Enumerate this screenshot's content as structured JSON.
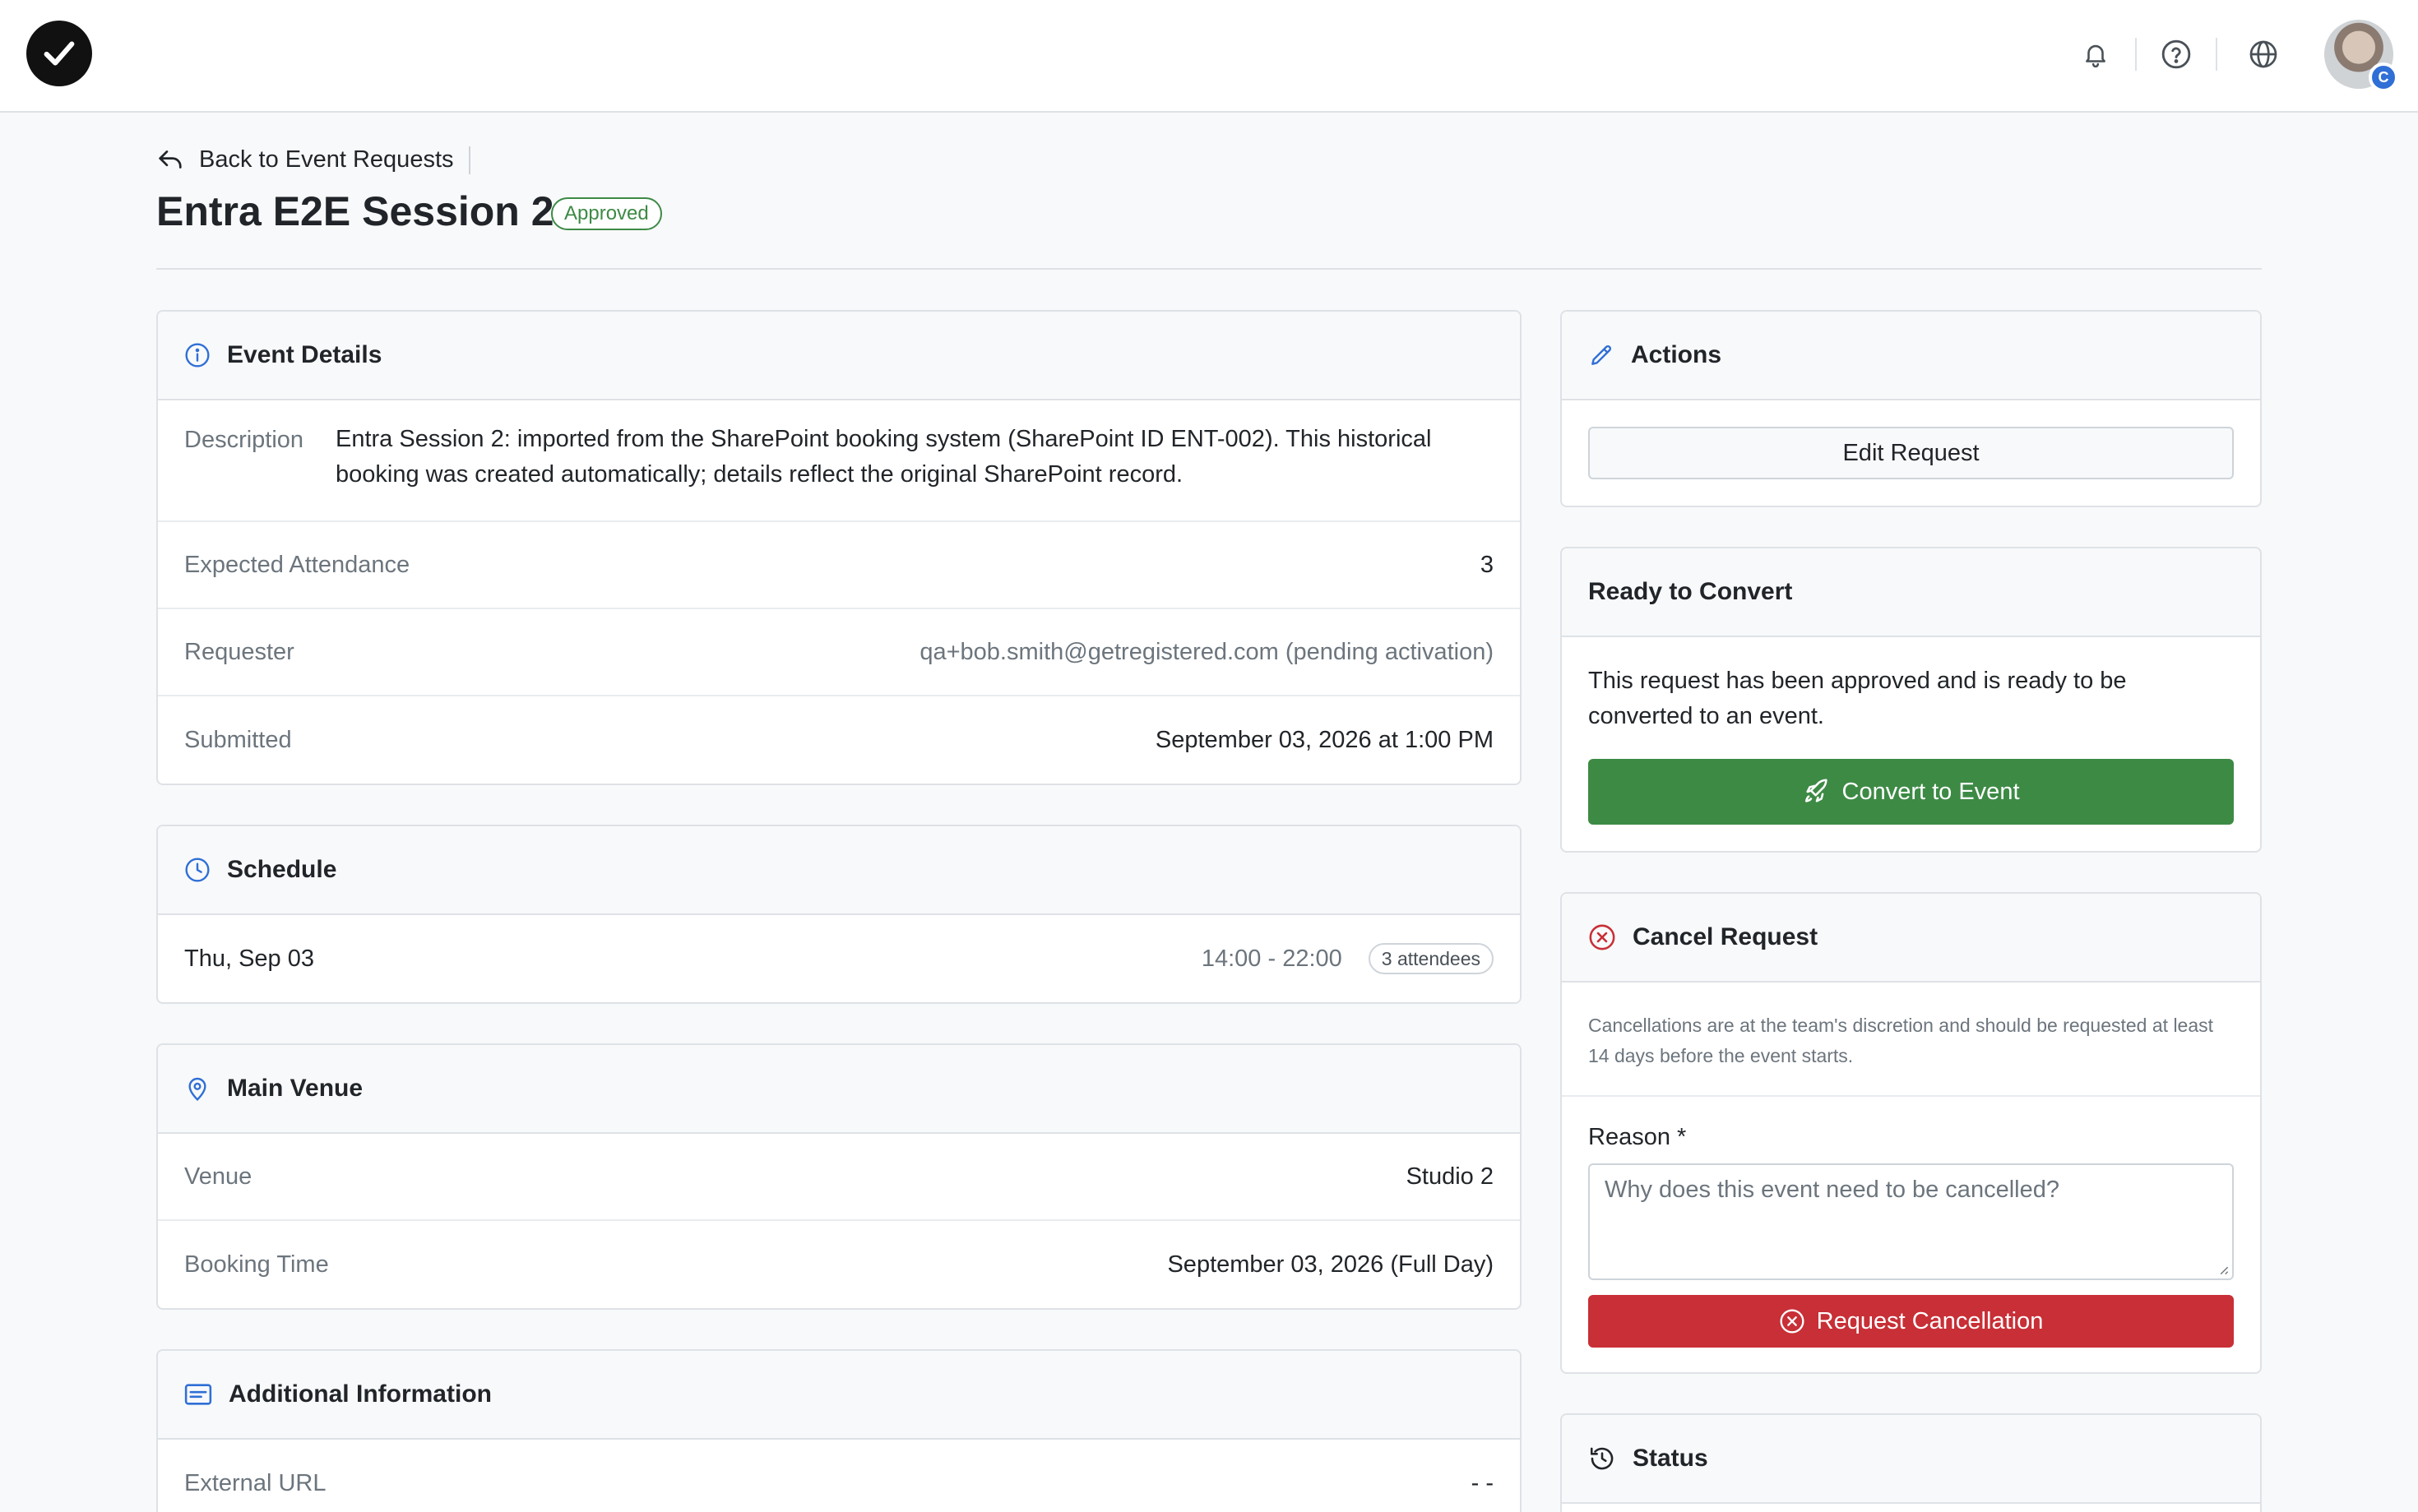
{
  "header": {
    "back_label": "Back to Event Requests",
    "title": "Entra E2E Session 2",
    "status_badge": "Approved"
  },
  "topbar": {
    "icons": [
      "bell-icon",
      "help-icon",
      "globe-icon"
    ],
    "avatar_badge": "C"
  },
  "event_details": {
    "title": "Event Details",
    "description_label": "Description",
    "description": "Entra Session 2: imported from the SharePoint booking system (SharePoint ID ENT-002). This historical booking was created automatically; details reflect the original SharePoint record.",
    "rows": [
      {
        "label": "Expected Attendance",
        "value": "3"
      },
      {
        "label": "Requester",
        "value": "qa+bob.smith@getregistered.com (pending activation)"
      },
      {
        "label": "Submitted",
        "value": "September 03, 2026 at 1:00 PM"
      }
    ]
  },
  "schedule": {
    "title": "Schedule",
    "day": "Thu, Sep 03",
    "time": "14:00 - 22:00",
    "attendees": "3 attendees"
  },
  "main_venue": {
    "title": "Main Venue",
    "rows": [
      {
        "label": "Venue",
        "value": "Studio 2"
      },
      {
        "label": "Booking Time",
        "value": "September 03, 2026 (Full Day)"
      }
    ]
  },
  "additional_info": {
    "title": "Additional Information",
    "rows": [
      {
        "label": "External URL",
        "value": "- -"
      }
    ]
  },
  "actions": {
    "title": "Actions",
    "edit_label": "Edit Request"
  },
  "ready_to_convert": {
    "title": "Ready to Convert",
    "message": "This request has been approved and is ready to be converted to an event.",
    "button_label": "Convert to Event"
  },
  "cancel_request": {
    "title": "Cancel Request",
    "notice": "Cancellations are at the team's discretion and should be requested at least 14 days before the event starts.",
    "reason_label": "Reason *",
    "reason_placeholder": "Why does this event need to be cancelled?",
    "button_label": "Request Cancellation"
  },
  "status": {
    "title": "Status"
  },
  "colors": {
    "accent_blue": "#2f6fd6",
    "success_green": "#3d8a45",
    "danger_red": "#c82f36"
  }
}
